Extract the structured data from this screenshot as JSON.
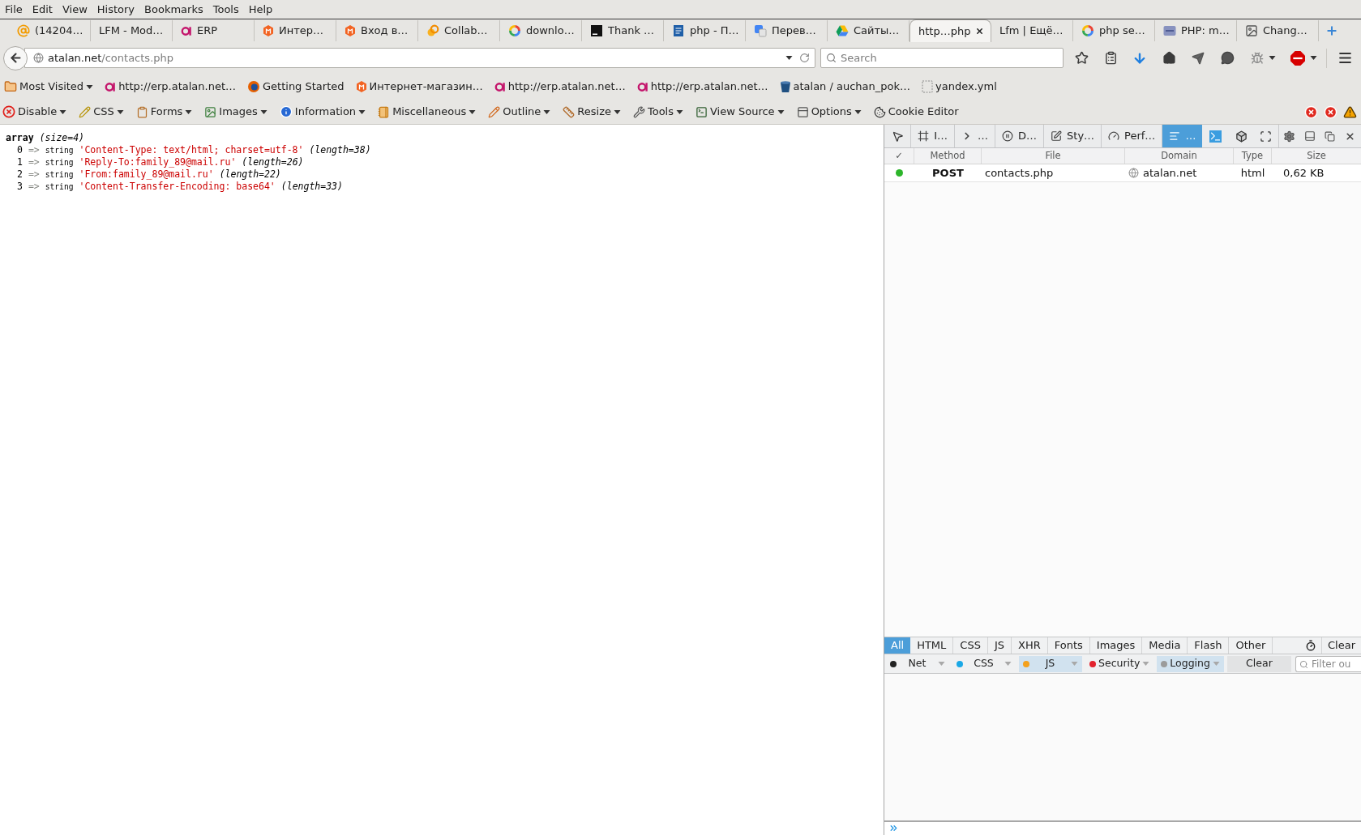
{
  "menu_bar": [
    "File",
    "Edit",
    "View",
    "History",
    "Bookmarks",
    "Tools",
    "Help"
  ],
  "tabs": [
    {
      "label": "(14204…",
      "selected": false
    },
    {
      "label": "LFM - Mod…",
      "selected": false
    },
    {
      "label": "ERP",
      "selected": false
    },
    {
      "label": "Интер…",
      "selected": false
    },
    {
      "label": "Вход в…",
      "selected": false
    },
    {
      "label": "Collab…",
      "selected": false
    },
    {
      "label": "downlo…",
      "selected": false
    },
    {
      "label": "Thank …",
      "selected": false
    },
    {
      "label": "php - П…",
      "selected": false
    },
    {
      "label": "Перев…",
      "selected": false
    },
    {
      "label": "Сайты…",
      "selected": false
    },
    {
      "label": "http…php",
      "selected": true
    },
    {
      "label": "Lfm | Ещё…",
      "selected": false
    },
    {
      "label": "php se…",
      "selected": false
    },
    {
      "label": "PHP: m…",
      "selected": false
    },
    {
      "label": "Chang…",
      "selected": false
    }
  ],
  "nav_bar": {
    "address": {
      "host": "atalan.net",
      "path": "/contacts.php"
    },
    "search": {
      "placeholder": "Search"
    }
  },
  "bookmarks": [
    {
      "label": "Most Visited",
      "kind": "folder"
    },
    {
      "label": "http://erp.atalan.net…",
      "kind": "link"
    },
    {
      "label": "Getting Started",
      "kind": "link"
    },
    {
      "label": "Интернет-магазин…",
      "kind": "link"
    },
    {
      "label": "http://erp.atalan.net…",
      "kind": "link"
    },
    {
      "label": "http://erp.atalan.net…",
      "kind": "link"
    },
    {
      "label": "atalan / auchan_pok…",
      "kind": "link"
    },
    {
      "label": "yandex.yml",
      "kind": "link"
    }
  ],
  "developer_toolbar": [
    {
      "label": "Disable",
      "kind": "menu"
    },
    {
      "label": "CSS",
      "kind": "menu"
    },
    {
      "label": "Forms",
      "kind": "menu"
    },
    {
      "label": "Images",
      "kind": "menu"
    },
    {
      "label": "Information",
      "kind": "menu"
    },
    {
      "label": "Miscellaneous",
      "kind": "menu"
    },
    {
      "label": "Outline",
      "kind": "menu"
    },
    {
      "label": "Resize",
      "kind": "menu"
    },
    {
      "label": "Tools",
      "kind": "menu"
    },
    {
      "label": "View Source",
      "kind": "menu"
    },
    {
      "label": "Options",
      "kind": "menu"
    },
    {
      "label": "Cookie Editor",
      "kind": "button"
    }
  ],
  "page": {
    "dump": {
      "type": "array",
      "size": "(size=4)",
      "entries": [
        {
          "key": "0",
          "arrow": "=>",
          "type": "string",
          "value": "'Content-Type: text/html; charset=utf-8'",
          "length": "(length=38)"
        },
        {
          "key": "1",
          "arrow": "=>",
          "type": "string",
          "value": "'Reply-To:family_89@mail.ru'",
          "length": "(length=26)"
        },
        {
          "key": "2",
          "arrow": "=>",
          "type": "string",
          "value": "'From:family_89@mail.ru'",
          "length": "(length=22)"
        },
        {
          "key": "3",
          "arrow": "=>",
          "type": "string",
          "value": "'Content-Transfer-Encoding: base64'",
          "length": "(length=33)"
        }
      ]
    }
  },
  "devtools": {
    "tabs": [
      {
        "label": "I…",
        "selected": false
      },
      {
        "label": "…",
        "selected": false
      },
      {
        "label": "D…",
        "selected": false
      },
      {
        "label": "Sty…",
        "selected": false
      },
      {
        "label": "Perf…",
        "selected": false
      },
      {
        "label": "…",
        "selected": true
      }
    ],
    "network": {
      "columns": [
        "✓",
        "Method",
        "File",
        "Domain",
        "Type",
        "Size"
      ],
      "rows": [
        {
          "color": "#2cb52a",
          "method": "POST",
          "file": "contacts.php",
          "domain": "atalan.net",
          "type": "html",
          "size": "0,62 KB"
        }
      ],
      "filters": [
        {
          "label": "All",
          "selected": true
        },
        {
          "label": "HTML",
          "selected": false
        },
        {
          "label": "CSS",
          "selected": false
        },
        {
          "label": "JS",
          "selected": false
        },
        {
          "label": "XHR",
          "selected": false
        },
        {
          "label": "Fonts",
          "selected": false
        },
        {
          "label": "Images",
          "selected": false
        },
        {
          "label": "Media",
          "selected": false
        },
        {
          "label": "Flash",
          "selected": false
        },
        {
          "label": "Other",
          "selected": false
        }
      ],
      "clear": "Clear"
    },
    "console": {
      "filters": [
        {
          "label": "Net",
          "color": "#222222",
          "selected": false
        },
        {
          "label": "CSS",
          "color": "#1aa8e6",
          "selected": false
        },
        {
          "label": "JS",
          "color": "#f4a11c",
          "selected": true
        },
        {
          "label": "Security",
          "color": "#e3232e",
          "selected": false
        },
        {
          "label": "Logging",
          "color": "#9b9b9b",
          "selected": true
        }
      ],
      "clear": "Clear",
      "filter": {
        "placeholder": "Filter ou"
      }
    }
  }
}
